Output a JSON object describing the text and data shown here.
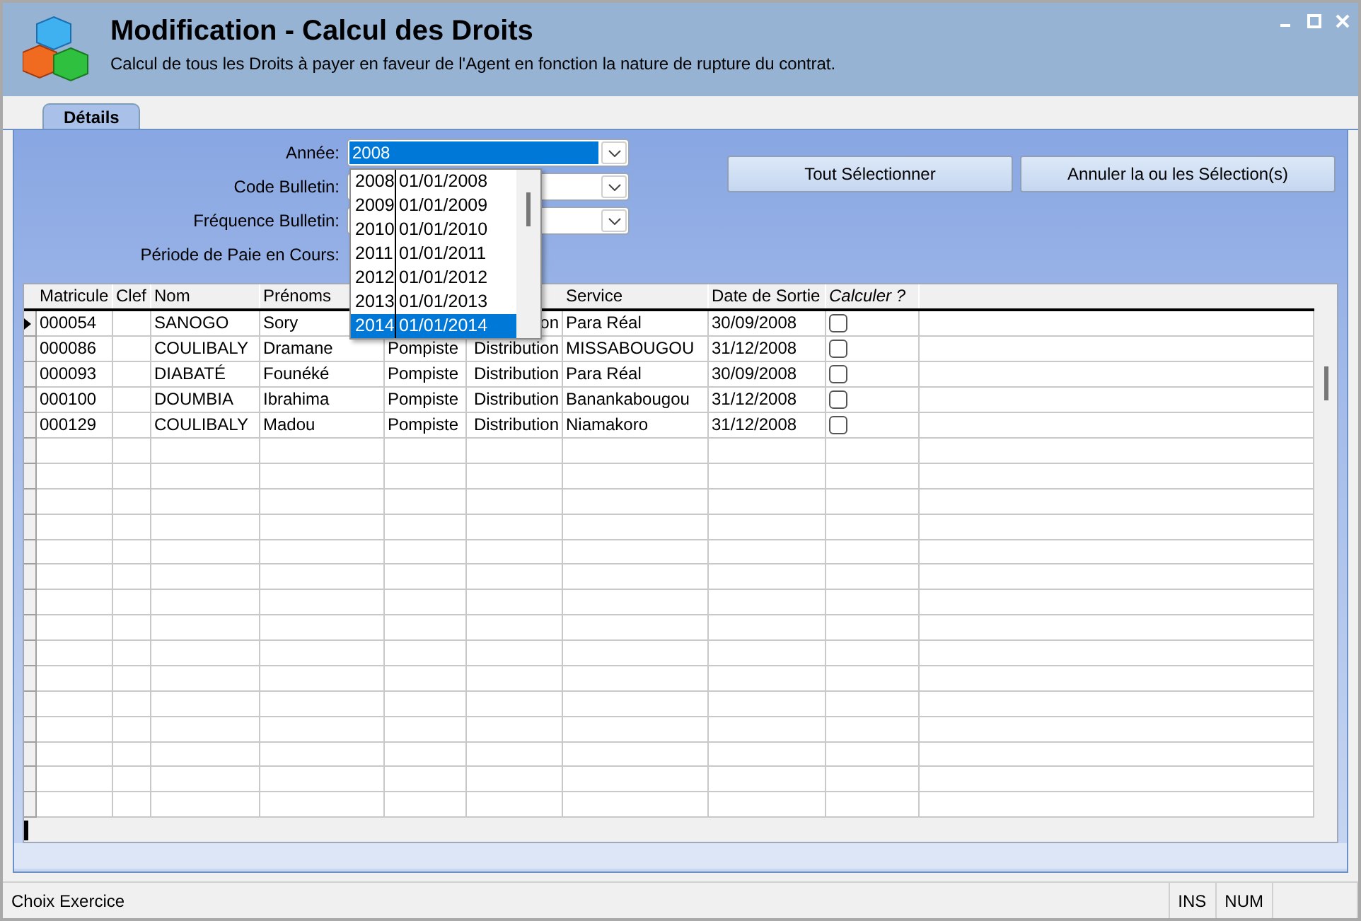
{
  "window": {
    "title": "Modification - Calcul des Droits",
    "subtitle": "Calcul de tous les Droits à payer en faveur de l'Agent en fonction la nature de rupture du contrat."
  },
  "tabs": [
    {
      "label": "Détails",
      "selected": true
    }
  ],
  "form": [
    {
      "label": "Année:",
      "kind": "combo",
      "value": "2008",
      "highlighted": true
    },
    {
      "label": "Code Bulletin:",
      "kind": "combo",
      "highlighted": false
    },
    {
      "label": "Fréquence Bulletin:",
      "kind": "combo",
      "highlighted": false
    },
    {
      "label": "Période de Paie en Cours:"
    }
  ],
  "dropdown": {
    "items": [
      {
        "year": "2008",
        "date": "01/01/2008",
        "selected": false
      },
      {
        "year": "2009",
        "date": "01/01/2009",
        "selected": false
      },
      {
        "year": "2010",
        "date": "01/01/2010",
        "selected": false
      },
      {
        "year": "2011",
        "date": "01/01/2011",
        "selected": false
      },
      {
        "year": "2012",
        "date": "01/01/2012",
        "selected": false
      },
      {
        "year": "2013",
        "date": "01/01/2013",
        "selected": false
      },
      {
        "year": "2014",
        "date": "01/01/2014",
        "selected": true
      }
    ]
  },
  "buttons": [
    "Tout Sélectionner",
    "Annuler la ou les Sélection(s)"
  ],
  "table": {
    "columns": [
      {
        "label": "Matricule"
      },
      {
        "label": "Clef"
      },
      {
        "label": "Nom"
      },
      {
        "label": "Prénoms"
      },
      {},
      {},
      {
        "label": "Service"
      },
      {
        "label": "Date de Sortie"
      },
      {
        "label": "Calculer ?",
        "kind": "checkbox"
      }
    ],
    "rows": [
      {
        "current": true,
        "cells": [
          "000054",
          null,
          "SANOGO",
          "Sory",
          null,
          "on",
          "Para Réal",
          "30/09/2008"
        ],
        "checked": false
      },
      {
        "current": false,
        "cells": [
          "000086",
          null,
          "COULIBALY",
          "Dramane",
          "Pompiste",
          "Distribution",
          "MISSABOUGOU",
          "31/12/2008"
        ],
        "checked": false
      },
      {
        "current": false,
        "cells": [
          "000093",
          null,
          "DIABATÉ",
          "Founéké",
          "Pompiste",
          "Distribution",
          "Para Réal",
          "30/09/2008"
        ],
        "checked": false
      },
      {
        "current": false,
        "cells": [
          "000100",
          null,
          "DOUMBIA",
          "Ibrahima",
          "Pompiste",
          "Distribution",
          "Banankabougou",
          "31/12/2008"
        ],
        "checked": false
      },
      {
        "current": false,
        "cells": [
          "000129",
          null,
          "COULIBALY",
          "Madou",
          "Pompiste",
          "Distribution",
          "Niamakoro",
          "31/12/2008"
        ],
        "checked": false
      }
    ]
  },
  "status_bar": [
    "Choix Exercice",
    "INS",
    "NUM"
  ]
}
